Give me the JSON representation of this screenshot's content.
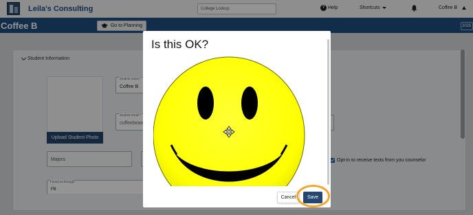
{
  "header": {
    "brand": "Leila's Consulting",
    "lookup_placeholder": "College Lookup",
    "help_label": "Help",
    "shortcuts_label": "Shortcuts",
    "user_label": "Coffee B"
  },
  "titlebar": {
    "page_title": "Coffee B",
    "go_planning_label": "Go to Planning",
    "year_label": "2025"
  },
  "form": {
    "section_title": "Student Information",
    "upload_photo_label": "Upload Student Photo",
    "student_name_label": "Student name *",
    "student_name_value": "Coffee B",
    "student_email_label": "Student Email *",
    "student_email_value": "coffeebeans",
    "majors_placeholder": "Majors",
    "optin_label": "Opt-in to receive texts from you counselor",
    "optin_checked": true,
    "found_label": "Found us through",
    "found_value": "FB"
  },
  "modal": {
    "title": "Is this OK?",
    "cancel_label": "Cancel",
    "save_label": "Save"
  },
  "colors": {
    "nav_blue": "#1f4e80",
    "button_blue": "#24476f",
    "highlight_orange": "#f2a72e",
    "smiley_yellow": "#ffff00"
  }
}
